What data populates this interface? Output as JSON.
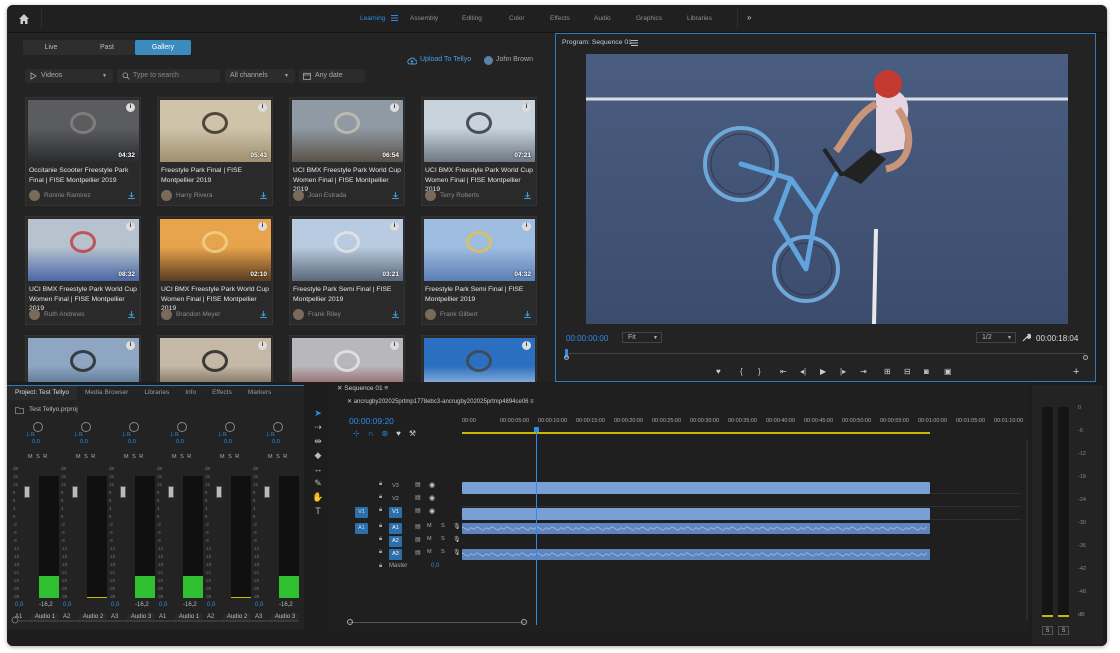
{
  "topbar": {
    "workspaces": [
      "Learning",
      "Assembly",
      "Editing",
      "Color",
      "Effects",
      "Audio",
      "Graphics",
      "Libraries"
    ],
    "active": "Learning",
    "more": "»"
  },
  "library": {
    "tabs": [
      "Live",
      "Past",
      "Gallery"
    ],
    "active_tab": "Gallery",
    "upload": "Upload To Tellyo",
    "user": "John Brown",
    "filter_type": "Videos",
    "search_placeholder": "Type to search",
    "channels": "All channels",
    "date": "Any date",
    "cards": [
      {
        "title": "Occitanie Scooter Freestyle Park Final | FISE Montpellier 2019",
        "author": "Ronnie Ramirez",
        "duration": "04:32"
      },
      {
        "title": "Freestyle Park Final | FISE Montpellier 2019",
        "author": "Harry Rivera",
        "duration": "05:43"
      },
      {
        "title": "UCI BMX Freestyle Park World Cup Women Final | FISE Montpellier 2019",
        "author": "Joan Estrada",
        "duration": "06:54"
      },
      {
        "title": "UCI BMX Freestyle Park World Cup Women Final | FISE Montpellier 2019",
        "author": "Terry Roberts",
        "duration": "07:21"
      },
      {
        "title": "UCI BMX Freestyle Park World Cup Women Final | FISE Montpellier 2019",
        "author": "Ruth Andrews",
        "duration": "08:32"
      },
      {
        "title": "UCI BMX Freestyle Park World Cup Women Final | FISE Montpellier 2019",
        "author": "Brandon Meyer",
        "duration": "02:10"
      },
      {
        "title": "Freestyle Park Semi Final | FISE Montpellier 2019",
        "author": "Frank Riley",
        "duration": "03:21"
      },
      {
        "title": "Freestyle Park Semi Final | FISE Montpellier 2019",
        "author": "Frank Gilbert",
        "duration": "04:32"
      },
      {
        "title": "",
        "author": "",
        "duration": ""
      },
      {
        "title": "",
        "author": "",
        "duration": ""
      },
      {
        "title": "",
        "author": "",
        "duration": ""
      },
      {
        "title": "",
        "author": "",
        "duration": ""
      }
    ]
  },
  "monitor": {
    "title": "Program: Sequence 01",
    "timecode_in": "00:00:00:00",
    "fit": "Fit",
    "resolution": "1/2",
    "timecode_out": "00:00:18:04"
  },
  "project": {
    "tabs": [
      "Project: Test Tellyo",
      "Media Browser",
      "Libraries",
      "Info",
      "Effects",
      "Markers"
    ],
    "file": "Test Tellyo.prproj",
    "channels": [
      {
        "value": "0,0",
        "db": "-16,2",
        "track": "A1",
        "name": "Audio 1",
        "level": 0.18
      },
      {
        "value": "0,0",
        "db": "",
        "track": "A2",
        "name": "Audio 2",
        "level": 0.0
      },
      {
        "value": "0,0",
        "db": "-16,2",
        "track": "A3",
        "name": "Audio 3",
        "level": 0.18
      },
      {
        "value": "0,0",
        "db": "-16,2",
        "track": "A1",
        "name": "Audio 1",
        "level": 0.18
      },
      {
        "value": "0,0",
        "db": "",
        "track": "A2",
        "name": "Audio 2",
        "level": 0.0
      },
      {
        "value": "0,0",
        "db": "-16,2",
        "track": "A3",
        "name": "Audio 3",
        "level": 0.18
      }
    ],
    "knob_label": "L   R",
    "msr": "M S R"
  },
  "sequence": {
    "tab": "Sequence 01",
    "name": "ancrugby202025prtmp1778ebc3-ancrugby202025prtmp4894ce06",
    "timecode": "00:00:09:20",
    "ruler": [
      "00:00",
      "00:00:05:00",
      "00:00:10:00",
      "00:00:15:00",
      "00:00:20:00",
      "00:00:25:00",
      "00:00:30:00",
      "00:00:35:00",
      "00:00:40:00",
      "00:00:45:00",
      "00:00:50:00",
      "00:00:55:00",
      "00:01:00:00",
      "00:01:05:00",
      "00:01:10:00"
    ],
    "video_tracks": [
      "V3",
      "V2",
      "V1"
    ],
    "audio_tracks": [
      "A1",
      "A2",
      "A3"
    ],
    "master": "Master",
    "master_value": "0,0"
  },
  "vu": {
    "labels": [
      "0",
      "-6",
      "-12",
      "-18",
      "-24",
      "-30",
      "-36",
      "-42",
      "-48",
      "dB"
    ],
    "solo": "S"
  }
}
